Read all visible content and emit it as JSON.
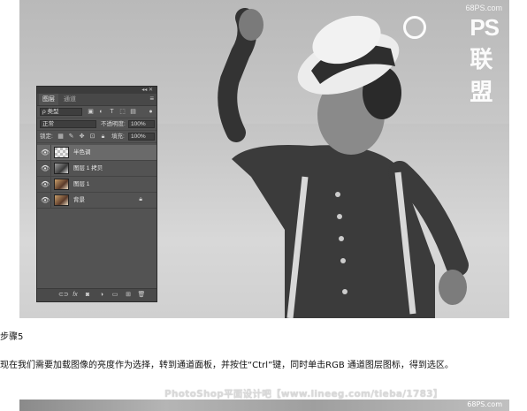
{
  "watermark": {
    "site": "68PS.com",
    "logo_text": "PS联盟"
  },
  "panel": {
    "tabs": [
      "图层",
      "通道"
    ],
    "filter_label": "ρ 类型",
    "blend_mode": "正常",
    "opacity_label": "不透明度:",
    "opacity_value": "100%",
    "lock_label": "锁定:",
    "fill_label": "填充:",
    "fill_value": "100%",
    "layers": [
      {
        "name": "半色调",
        "selected": true,
        "thumb": "checker"
      },
      {
        "name": "图层 1 拷贝",
        "selected": false,
        "thumb": "photo1"
      },
      {
        "name": "图层 1",
        "selected": false,
        "thumb": "photo2"
      },
      {
        "name": "背景",
        "selected": false,
        "thumb": "photo2",
        "locked": true
      }
    ]
  },
  "article": {
    "step_title": "步骤5",
    "body": "现在我们需要加载图像的亮度作为选择，转到通道面板，并按住“Ctrl”键，同时单击RGB 通道图层图标，得到选区。",
    "footer_watermark": "PhotoShop平面设计吧【www.lineeg.com/tieba/1783】",
    "strip_site": "68PS.com"
  }
}
